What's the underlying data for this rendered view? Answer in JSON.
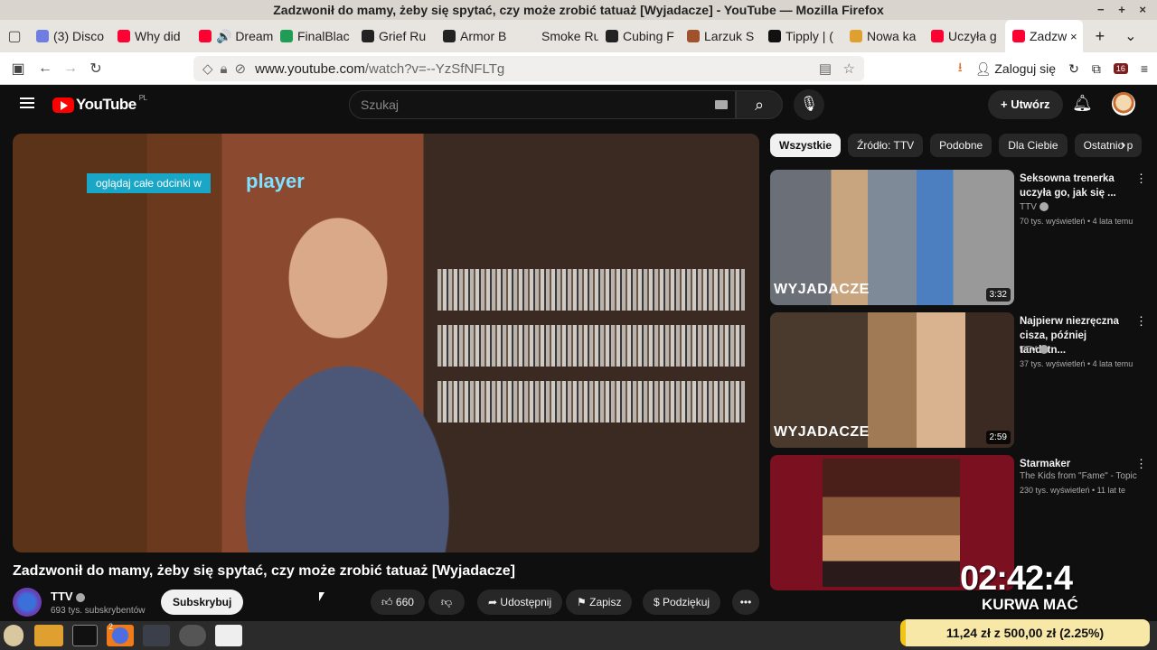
{
  "window": {
    "title": "Zadzwonił do mamy, żeby się spytać, czy może zrobić tatuaż [Wyjadacze] - YouTube — Mozilla Firefox",
    "controls": "− + ×"
  },
  "tabs": [
    {
      "label": "(3) Disco",
      "color": "#6f7de0"
    },
    {
      "label": "Why did",
      "color": "#ff0033"
    },
    {
      "label": "🔊 Dream",
      "color": "#ff0033"
    },
    {
      "label": "FinalBlac",
      "color": "#1f9d55"
    },
    {
      "label": "Grief Ru",
      "color": "#222222"
    },
    {
      "label": "Armor B",
      "color": "#222222"
    },
    {
      "label": "Smoke Run",
      "color": "#e8e5e1"
    },
    {
      "label": "Cubing F",
      "color": "#222222"
    },
    {
      "label": "Larzuk S",
      "color": "#a0522d"
    },
    {
      "label": "Tipply | (",
      "color": "#111111"
    },
    {
      "label": "Nowa ka",
      "color": "#e0a030"
    },
    {
      "label": "Uczyła g",
      "color": "#ff0033"
    },
    {
      "label": "Zadzw",
      "color": "#ff0033",
      "active": true
    }
  ],
  "tabbar": {
    "close": "×",
    "new_tab": "+",
    "list": "⌄"
  },
  "nav": {
    "back": "←",
    "forward": "→",
    "reload": "↻",
    "url_host": "www.youtube.com",
    "url_path": "/watch?v=--YzSfNFLTg",
    "login": "Zaloguj się",
    "ext_badge": "16"
  },
  "youtube": {
    "logo": "YouTube",
    "region": "PL",
    "search_placeholder": "Szukaj",
    "create": "+ Utwórz"
  },
  "video": {
    "overlay_text": "oglądaj całe odcinki w",
    "overlay_brand": "player",
    "title": "Zadzwonił do mamy, żeby się spytać, czy może zrobić tatuaż [Wyjadacze]",
    "channel": "TTV",
    "subscribers": "693 tys. subskrybentów",
    "subscribe": "Subskrybuj",
    "likes": "660",
    "share": "Udostępnij",
    "save": "Zapisz",
    "thanks": "Podziękuj",
    "more": "•••"
  },
  "chips": [
    "Wszystkie",
    "Źródło: TTV",
    "Podobne",
    "Dla Ciebie",
    "Ostatnio p"
  ],
  "recommendations": [
    {
      "title": "Seksowna trenerka uczyła go, jak się ...",
      "channel": "TTV",
      "meta": "70 tys. wyświetleń • 4 lata temu",
      "duration": "3:32",
      "watermark": "WYJADACZE"
    },
    {
      "title": "Najpierw niezręczna cisza, później tandetn...",
      "channel": "TTV",
      "meta": "37 tys. wyświetleń • 4 lata temu",
      "duration": "2:59",
      "watermark": "WYJADACZE"
    },
    {
      "title": "Starmaker",
      "channel": "The Kids from \"Fame\" - Topic",
      "meta": "230 tys. wyświetleń • 11 lat te",
      "duration": "",
      "watermark": ""
    }
  ],
  "stream_overlay": {
    "clock": "02:42:4",
    "caption": "KURWA MAĆ",
    "donation": "11,24 zł z 500,00 zł (2.25%)",
    "donation_progress_percent": 2.25
  },
  "taskbar": {
    "badge": "2"
  }
}
